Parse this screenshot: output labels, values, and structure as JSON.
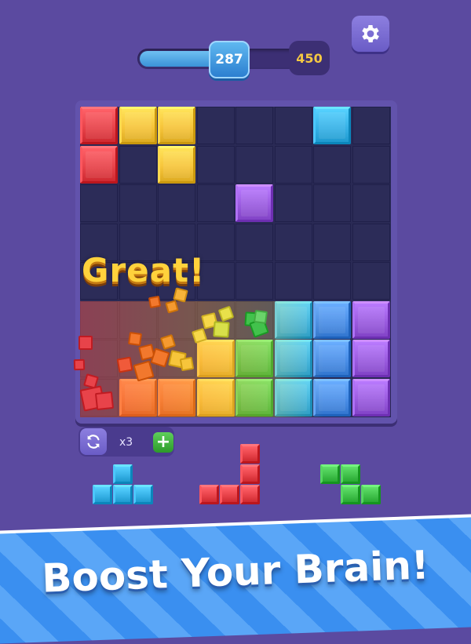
{
  "progress": {
    "current": "287",
    "target": "450",
    "fill_fraction": 0.64
  },
  "settings": {
    "icon": "gear-icon"
  },
  "praise": {
    "text": "Great!"
  },
  "swap": {
    "count_label": "x3",
    "swap_icon": "refresh-icon",
    "add_icon": "plus-icon"
  },
  "banner": {
    "text": "Boost Your Brain!"
  },
  "colors": {
    "red": "#e8434a",
    "orange": "#f2782d",
    "yellow": "#f7c53b",
    "green": "#42c24c",
    "cyan": "#38b3e8",
    "blue": "#4b8fe8",
    "purple": "#9b5ce0",
    "accent": "#5b4aa0"
  },
  "board": {
    "grid_size": 8,
    "blocks": [
      {
        "row": 0,
        "col": 0,
        "color": "red"
      },
      {
        "row": 0,
        "col": 1,
        "color": "yellow"
      },
      {
        "row": 0,
        "col": 2,
        "color": "yellow"
      },
      {
        "row": 0,
        "col": 6,
        "color": "cyan"
      },
      {
        "row": 1,
        "col": 0,
        "color": "red"
      },
      {
        "row": 1,
        "col": 2,
        "color": "yellow"
      },
      {
        "row": 2,
        "col": 4,
        "color": "purple"
      },
      {
        "row": 5,
        "col": 5,
        "color": "cyan"
      },
      {
        "row": 5,
        "col": 6,
        "color": "blue"
      },
      {
        "row": 5,
        "col": 7,
        "color": "purple"
      },
      {
        "row": 6,
        "col": 3,
        "color": "yellow"
      },
      {
        "row": 6,
        "col": 4,
        "color": "green"
      },
      {
        "row": 6,
        "col": 5,
        "color": "cyan"
      },
      {
        "row": 6,
        "col": 6,
        "color": "blue"
      },
      {
        "row": 6,
        "col": 7,
        "color": "purple"
      },
      {
        "row": 7,
        "col": 1,
        "color": "orange"
      },
      {
        "row": 7,
        "col": 2,
        "color": "orange"
      },
      {
        "row": 7,
        "col": 3,
        "color": "yellow"
      },
      {
        "row": 7,
        "col": 4,
        "color": "green"
      },
      {
        "row": 7,
        "col": 5,
        "color": "cyan"
      },
      {
        "row": 7,
        "col": 6,
        "color": "blue"
      },
      {
        "row": 7,
        "col": 7,
        "color": "purple"
      }
    ]
  },
  "pieces": [
    {
      "name": "t-piece",
      "color": "cyan",
      "cells": [
        [
          0,
          1
        ],
        [
          1,
          0
        ],
        [
          1,
          1
        ],
        [
          1,
          2
        ]
      ]
    },
    {
      "name": "j-piece",
      "color": "red",
      "cells": [
        [
          0,
          2
        ],
        [
          1,
          2
        ],
        [
          2,
          0
        ],
        [
          2,
          1
        ],
        [
          2,
          2
        ]
      ]
    },
    {
      "name": "z-piece",
      "color": "green",
      "cells": [
        [
          0,
          0
        ],
        [
          0,
          1
        ],
        [
          1,
          1
        ],
        [
          1,
          2
        ]
      ]
    }
  ]
}
